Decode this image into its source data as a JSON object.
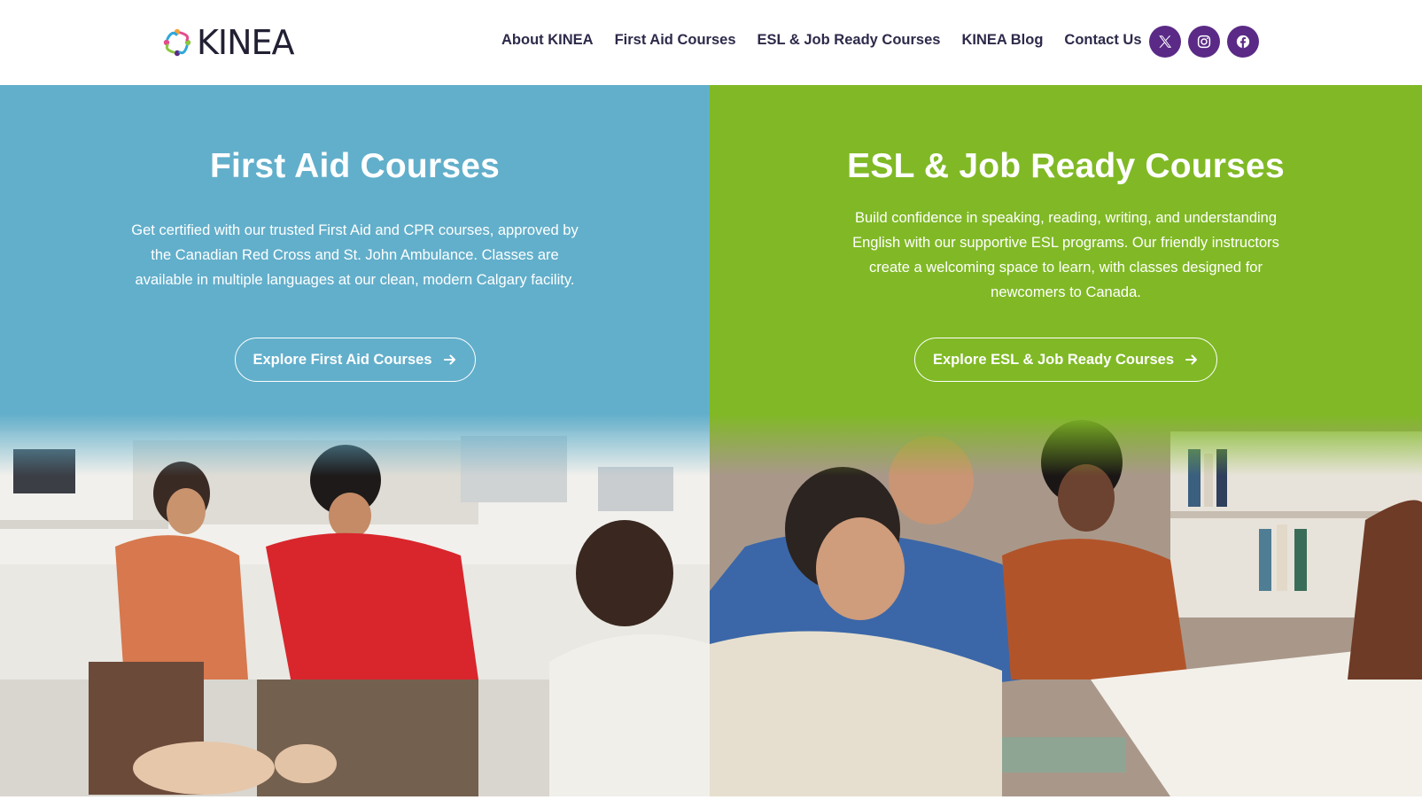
{
  "header": {
    "logo_text": "KINEA",
    "nav": [
      {
        "label": "About KINEA"
      },
      {
        "label": "First Aid Courses"
      },
      {
        "label": "ESL & Job Ready Courses"
      },
      {
        "label": "KINEA Blog"
      },
      {
        "label": "Contact Us"
      }
    ],
    "social": [
      {
        "icon": "x-twitter-icon"
      },
      {
        "icon": "instagram-icon"
      },
      {
        "icon": "facebook-icon"
      }
    ]
  },
  "first_aid": {
    "title": "First Aid Courses",
    "description": "Get certified with our trusted First Aid and CPR courses, approved by the Canadian Red Cross and St. John Ambulance. Classes are available in multiple languages at our clean, modern Calgary facility.",
    "button_label": "Explore First Aid Courses",
    "image_icon": "cpr-training-photo"
  },
  "esl": {
    "title": "ESL & Job Ready Courses",
    "description": "Build confidence in speaking, reading, writing, and understanding English with our supportive ESL programs. Our friendly instructors create a welcoming space to learn, with classes designed for newcomers to Canada.",
    "button_label": "Explore ESL & Job Ready Courses",
    "image_icon": "esl-classroom-photo"
  },
  "colors": {
    "first_aid_bg": "#62afcb",
    "esl_bg": "#80b925",
    "social_bg": "#5a2a86",
    "nav_text": "#2d2a4a"
  }
}
